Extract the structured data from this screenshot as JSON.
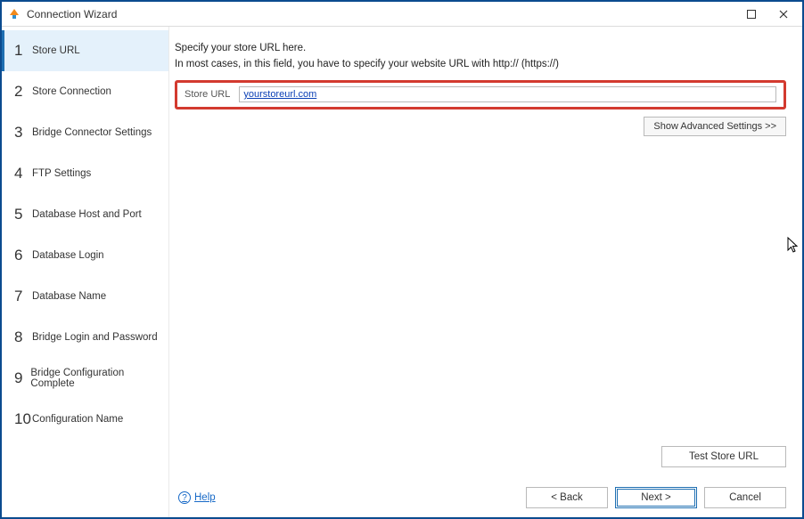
{
  "window": {
    "title": "Connection Wizard"
  },
  "sidebar": {
    "steps": [
      {
        "num": "1",
        "label": "Store URL"
      },
      {
        "num": "2",
        "label": "Store Connection"
      },
      {
        "num": "3",
        "label": "Bridge Connector Settings"
      },
      {
        "num": "4",
        "label": "FTP Settings"
      },
      {
        "num": "5",
        "label": "Database Host and Port"
      },
      {
        "num": "6",
        "label": "Database Login"
      },
      {
        "num": "7",
        "label": "Database Name"
      },
      {
        "num": "8",
        "label": "Bridge Login and Password"
      },
      {
        "num": "9",
        "label": "Bridge Configuration Complete"
      },
      {
        "num": "10",
        "label": "Configuration Name"
      }
    ],
    "selected_index": 0
  },
  "main": {
    "intro_line1": "Specify your store URL here.",
    "intro_line2": "In most cases, in this field, you have to specify your website URL with http:// (https://)",
    "store_url_label": "Store URL",
    "store_url_value": "yourstoreurl.com",
    "show_advanced_label": "Show Advanced Settings >>",
    "test_button_label": "Test Store URL"
  },
  "footer": {
    "help_label": "Help",
    "back_label": "< Back",
    "next_label": "Next >",
    "cancel_label": "Cancel"
  }
}
